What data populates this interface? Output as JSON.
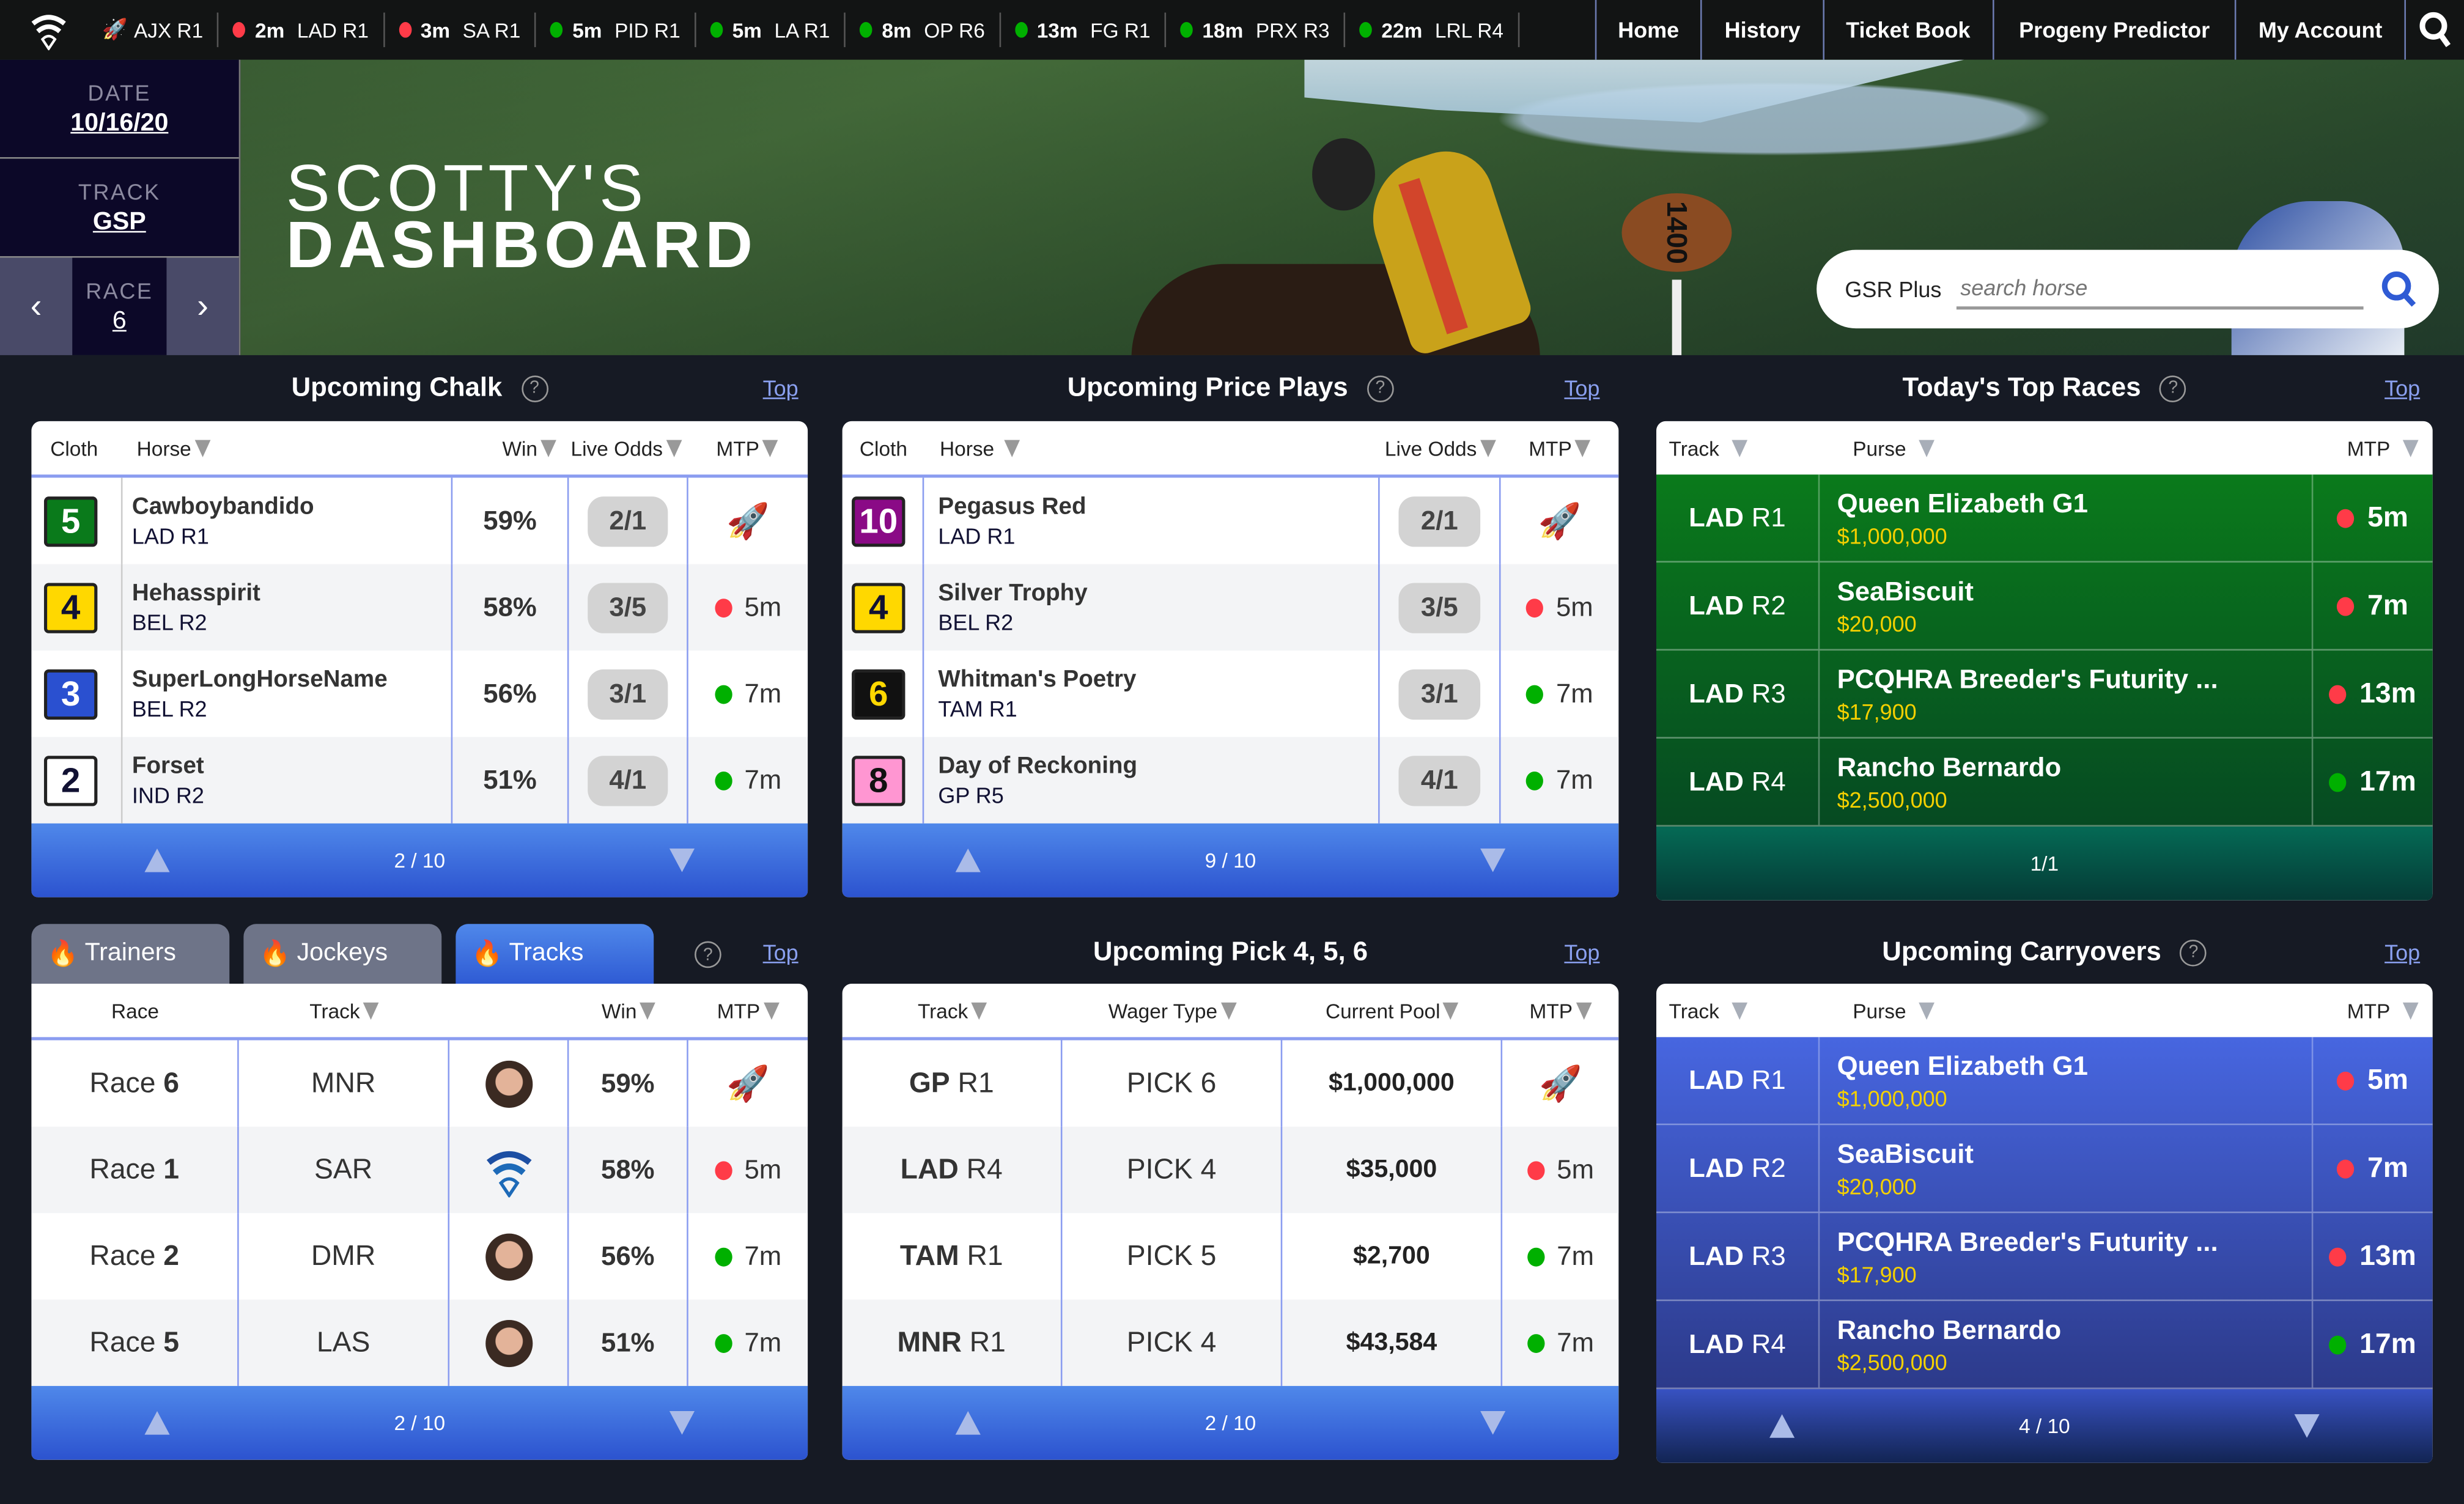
{
  "topbar": {
    "ticker": [
      {
        "icon": "rocket",
        "mtp": "",
        "race": "AJX R1"
      },
      {
        "status": "red",
        "mtp": "2m",
        "race": "LAD R1"
      },
      {
        "status": "red",
        "mtp": "3m",
        "race": "SA R1"
      },
      {
        "status": "green",
        "mtp": "5m",
        "race": "PID R1"
      },
      {
        "status": "green",
        "mtp": "5m",
        "race": "LA R1"
      },
      {
        "status": "green",
        "mtp": "8m",
        "race": "OP R6"
      },
      {
        "status": "green",
        "mtp": "13m",
        "race": "FG R1"
      },
      {
        "status": "green",
        "mtp": "18m",
        "race": "PRX R3"
      },
      {
        "status": "green",
        "mtp": "22m",
        "race": "LRL R4"
      }
    ],
    "nav": [
      "Home",
      "History",
      "Ticket Book",
      "Progeny Predictor",
      "My Account"
    ],
    "search_icon": "search-icon"
  },
  "colors": {
    "red": "#ff3b48",
    "green": "#00b000",
    "accent": "#2f5bd4",
    "purse": "#f4d000"
  },
  "sidebar": {
    "date_label": "DATE",
    "date_value": "10/16/20",
    "track_label": "TRACK",
    "track_value": "GSP",
    "race_label": "RACE",
    "race_value": "6",
    "prev": "‹",
    "next": "›"
  },
  "hero": {
    "title_line1": "SCOTTY'S",
    "title_line2": "DASHBOARD",
    "sign_text": "1400",
    "search_brand": "GSR Plus",
    "search_placeholder": "search horse"
  },
  "chalk": {
    "title": "Upcoming Chalk",
    "top": "Top",
    "help": "?",
    "headers": [
      "Cloth",
      "Horse",
      "Win",
      "Live Odds",
      "MTP"
    ],
    "rows": [
      {
        "cloth": "5",
        "bg": "#0a7a1b",
        "fg": "#ffffff",
        "horse": "Cawboybandido",
        "race": "LAD R1",
        "win": "59%",
        "odds": "2/1",
        "mtp": "",
        "rocket": true
      },
      {
        "cloth": "4",
        "bg": "#ffd800",
        "fg": "#111133",
        "horse": "Hehasspirit",
        "race": "BEL R2",
        "win": "58%",
        "odds": "3/5",
        "mtp": "5m",
        "status": "red"
      },
      {
        "cloth": "3",
        "bg": "#2a50d0",
        "fg": "#ffffff",
        "horse": "SuperLongHorseName",
        "race": "BEL R2",
        "win": "56%",
        "odds": "3/1",
        "mtp": "7m",
        "status": "green"
      },
      {
        "cloth": "2",
        "bg": "#ffffff",
        "fg": "#111133",
        "horse": "Forset",
        "race": "IND R2",
        "win": "51%",
        "odds": "4/1",
        "mtp": "7m",
        "status": "green"
      }
    ],
    "page": "2 / 10"
  },
  "price": {
    "title": "Upcoming Price Plays",
    "top": "Top",
    "help": "?",
    "headers": [
      "Cloth",
      "Horse",
      "Live Odds",
      "MTP"
    ],
    "rows": [
      {
        "cloth": "10",
        "bg": "#8a0a86",
        "fg": "#ffffff",
        "horse": "Pegasus Red",
        "race": "LAD R1",
        "odds": "2/1",
        "mtp": "",
        "rocket": true
      },
      {
        "cloth": "4",
        "bg": "#ffd800",
        "fg": "#111133",
        "horse": "Silver Trophy",
        "race": "BEL R2",
        "odds": "3/5",
        "mtp": "5m",
        "status": "red"
      },
      {
        "cloth": "6",
        "bg": "#111111",
        "fg": "#ffd800",
        "horse": "Whitman's Poetry",
        "race": "TAM R1",
        "odds": "3/1",
        "mtp": "7m",
        "status": "green"
      },
      {
        "cloth": "8",
        "bg": "#ff96d2",
        "fg": "#111111",
        "horse": "Day of Reckoning",
        "race": "GP R5",
        "odds": "4/1",
        "mtp": "7m",
        "status": "green"
      }
    ],
    "page": "9 / 10"
  },
  "topraces": {
    "title": "Today's Top Races",
    "top": "Top",
    "help": "?",
    "headers": [
      "Track",
      "Purse",
      "MTP"
    ],
    "rows": [
      {
        "track": "LAD",
        "race": "R1",
        "name": "Queen Elizabeth G1",
        "purse": "$1,000,000",
        "mtp": "5m",
        "status": "red"
      },
      {
        "track": "LAD",
        "race": "R2",
        "name": "SeaBiscuit",
        "purse": "$20,000",
        "mtp": "7m",
        "status": "red"
      },
      {
        "track": "LAD",
        "race": "R3",
        "name": "PCQHRA Breeder's Futurity ...",
        "purse": "$17,900",
        "mtp": "13m",
        "status": "red"
      },
      {
        "track": "LAD",
        "race": "R4",
        "name": "Rancho Bernardo",
        "purse": "$2,500,000",
        "mtp": "17m",
        "status": "green"
      }
    ],
    "page": "1/1"
  },
  "hot": {
    "tabs": [
      {
        "label": "Trainers",
        "active": false
      },
      {
        "label": "Jockeys",
        "active": false
      },
      {
        "label": "Tracks",
        "active": true
      }
    ],
    "top": "Top",
    "help": "?",
    "headers": [
      "Race",
      "Track",
      "",
      "Win",
      "MTP"
    ],
    "rows": [
      {
        "race_label": "Race",
        "race_num": "6",
        "track": "MNR",
        "img": "avatar",
        "win": "59%",
        "mtp": "",
        "rocket": true
      },
      {
        "race_label": "Race",
        "race_num": "1",
        "track": "SAR",
        "img": "logo",
        "win": "58%",
        "mtp": "5m",
        "status": "red"
      },
      {
        "race_label": "Race",
        "race_num": "2",
        "track": "DMR",
        "img": "avatar",
        "win": "56%",
        "mtp": "7m",
        "status": "green"
      },
      {
        "race_label": "Race",
        "race_num": "5",
        "track": "LAS",
        "img": "avatar",
        "win": "51%",
        "mtp": "7m",
        "status": "green"
      }
    ],
    "page": "2 / 10"
  },
  "picks": {
    "title": "Upcoming Pick 4, 5, 6",
    "top": "Top",
    "headers": [
      "Track",
      "Wager Type",
      "Current Pool",
      "MTP"
    ],
    "rows": [
      {
        "track": "GP",
        "race": "R1",
        "wager": "PICK 6",
        "pool": "$1,000,000",
        "mtp": "",
        "rocket": true
      },
      {
        "track": "LAD",
        "race": "R4",
        "wager": "PICK 4",
        "pool": "$35,000",
        "mtp": "5m",
        "status": "red"
      },
      {
        "track": "TAM",
        "race": "R1",
        "wager": "PICK 5",
        "pool": "$2,700",
        "mtp": "7m",
        "status": "green"
      },
      {
        "track": "MNR",
        "race": "R1",
        "wager": "PICK 4",
        "pool": "$43,584",
        "mtp": "7m",
        "status": "green"
      }
    ],
    "page": "2 / 10"
  },
  "carry": {
    "title": "Upcoming Carryovers",
    "top": "Top",
    "help": "?",
    "headers": [
      "Track",
      "Purse",
      "MTP"
    ],
    "rows": [
      {
        "track": "LAD",
        "race": "R1",
        "name": "Queen Elizabeth G1",
        "purse": "$1,000,000",
        "mtp": "5m",
        "status": "red"
      },
      {
        "track": "LAD",
        "race": "R2",
        "name": "SeaBiscuit",
        "purse": "$20,000",
        "mtp": "7m",
        "status": "red"
      },
      {
        "track": "LAD",
        "race": "R3",
        "name": "PCQHRA Breeder's Futurity ...",
        "purse": "$17,900",
        "mtp": "13m",
        "status": "red"
      },
      {
        "track": "LAD",
        "race": "R4",
        "name": "Rancho Bernardo",
        "purse": "$2,500,000",
        "mtp": "17m",
        "status": "green"
      }
    ],
    "page": "4 / 10"
  }
}
